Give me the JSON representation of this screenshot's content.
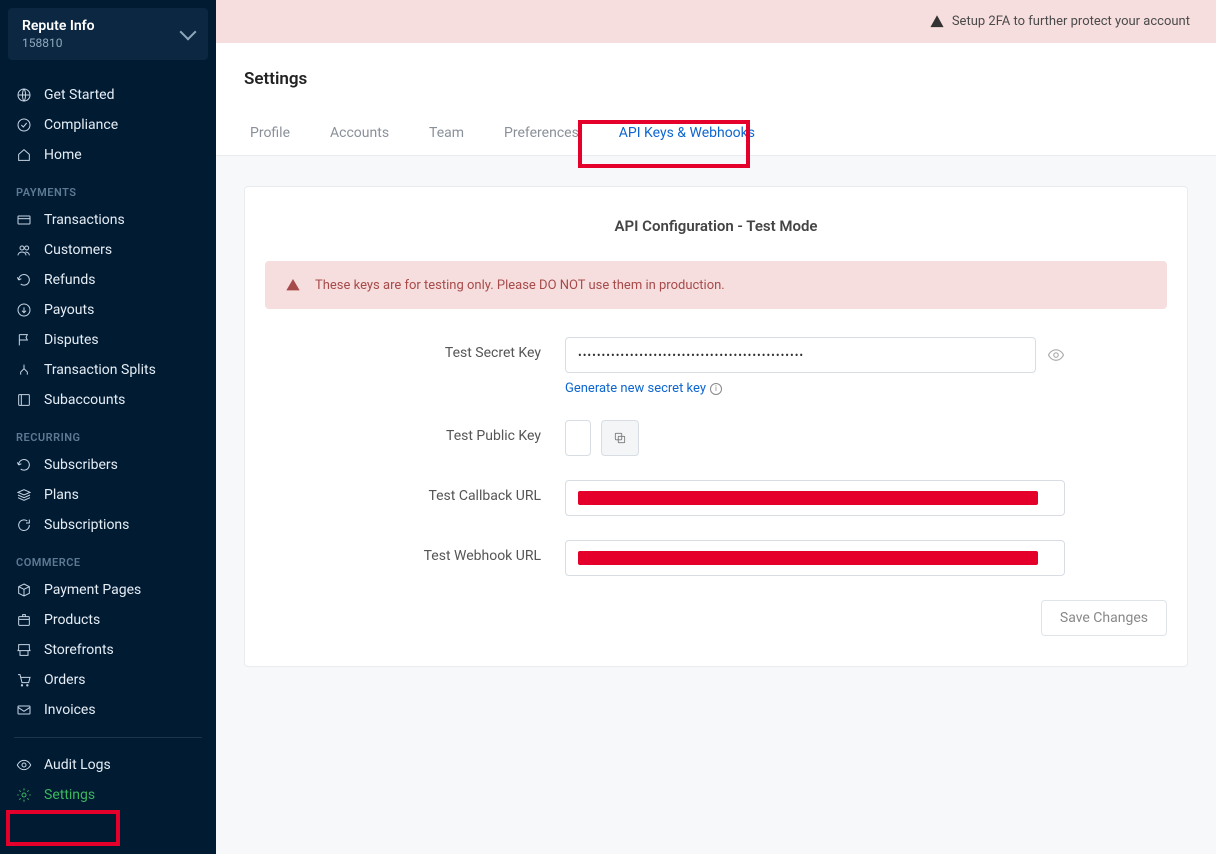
{
  "org": {
    "name": "Repute Info",
    "id": "158810"
  },
  "banner": {
    "text": "Setup 2FA to further protect your account"
  },
  "page": {
    "title": "Settings"
  },
  "tabs": [
    "Profile",
    "Accounts",
    "Team",
    "Preferences",
    "API Keys & Webhooks"
  ],
  "active_tab": 4,
  "sidebar": {
    "top": [
      {
        "label": "Get Started",
        "icon": "globe"
      },
      {
        "label": "Compliance",
        "icon": "check-circle"
      },
      {
        "label": "Home",
        "icon": "home"
      }
    ],
    "sections": [
      {
        "title": "PAYMENTS",
        "items": [
          {
            "label": "Transactions",
            "icon": "card"
          },
          {
            "label": "Customers",
            "icon": "users"
          },
          {
            "label": "Refunds",
            "icon": "undo"
          },
          {
            "label": "Payouts",
            "icon": "arrow-down-circle"
          },
          {
            "label": "Disputes",
            "icon": "flag"
          },
          {
            "label": "Transaction Splits",
            "icon": "split"
          },
          {
            "label": "Subaccounts",
            "icon": "subaccount"
          }
        ]
      },
      {
        "title": "RECURRING",
        "items": [
          {
            "label": "Subscribers",
            "icon": "undo"
          },
          {
            "label": "Plans",
            "icon": "stack"
          },
          {
            "label": "Subscriptions",
            "icon": "refresh"
          }
        ]
      },
      {
        "title": "COMMERCE",
        "items": [
          {
            "label": "Payment Pages",
            "icon": "cube"
          },
          {
            "label": "Products",
            "icon": "box"
          },
          {
            "label": "Storefronts",
            "icon": "store"
          },
          {
            "label": "Orders",
            "icon": "cart"
          },
          {
            "label": "Invoices",
            "icon": "mail"
          }
        ]
      }
    ],
    "bottom": [
      {
        "label": "Audit Logs",
        "icon": "eye"
      },
      {
        "label": "Settings",
        "icon": "gear",
        "active": true
      }
    ]
  },
  "card": {
    "title": "API Configuration - Test Mode",
    "alert": "These keys are for testing only. Please DO NOT use them in production.",
    "secret_label": "Test Secret Key",
    "secret_value": "••••••••••••••••••••••••••••••••••••••••••••••••",
    "gen_link": "Generate new secret key",
    "public_label": "Test Public Key",
    "callback_label": "Test Callback URL",
    "webhook_label": "Test Webhook URL",
    "save": "Save Changes"
  }
}
